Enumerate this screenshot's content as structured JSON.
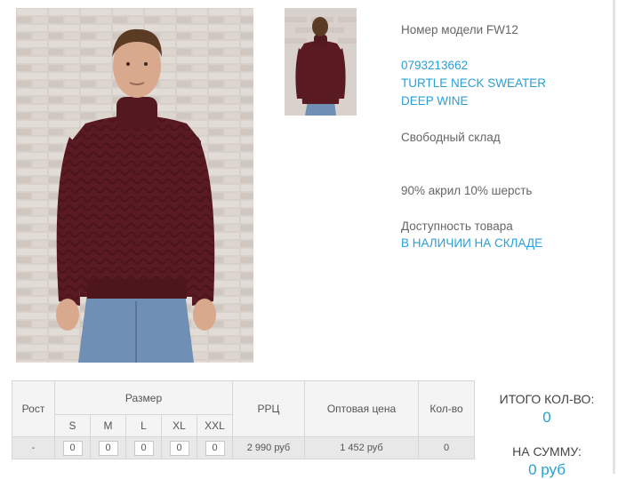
{
  "product": {
    "model": "Номер модели FW12",
    "article": "0793213662",
    "name_line1": "TURTLE NECK SWEATER",
    "name_line2": "DEEP WINE",
    "stock_type": "Свободный склад",
    "composition": "90% акрил 10% шерсть",
    "availability_label": "Доступность товара",
    "availability_value": "В НАЛИЧИИ НА СКЛАДЕ"
  },
  "images": {
    "main_icon": "model-front-photo",
    "thumb_icon": "model-back-photo",
    "sweater_color": "#5a1a22",
    "jeans_color": "#6f8fb4",
    "wall_color": "#d9d2cc"
  },
  "table": {
    "headers": {
      "height": "Рост",
      "size": "Размер",
      "rrp": "РРЦ",
      "wholesale": "Оптовая цена",
      "qty": "Кол-во"
    },
    "sizes": [
      "S",
      "M",
      "L",
      "XL",
      "XXL"
    ],
    "row": {
      "height": "-",
      "quantities": [
        "0",
        "0",
        "0",
        "0",
        "0"
      ],
      "rrp": "2 990 руб",
      "wholesale": "1 452 руб",
      "qty": "0"
    }
  },
  "totals": {
    "qty_label": "ИТОГО КОЛ-ВО:",
    "qty_value": "0",
    "sum_label": "НА СУММУ:",
    "sum_value": "0 руб"
  },
  "colors": {
    "accent": "#2a9fd6",
    "text": "#555555"
  }
}
